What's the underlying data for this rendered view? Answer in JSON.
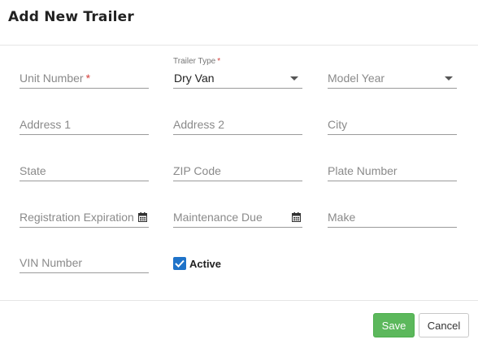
{
  "dialog": {
    "title": "Add New Trailer"
  },
  "form": {
    "unit_number": {
      "placeholder": "Unit Number",
      "required_mark": "*"
    },
    "trailer_type": {
      "label": "Trailer Type",
      "required_mark": "*",
      "value": "Dry Van"
    },
    "model_year": {
      "placeholder": "Model Year"
    },
    "address1": {
      "placeholder": "Address 1"
    },
    "address2": {
      "placeholder": "Address 2"
    },
    "city": {
      "placeholder": "City"
    },
    "state": {
      "placeholder": "State"
    },
    "zip": {
      "placeholder": "ZIP Code"
    },
    "plate_number": {
      "placeholder": "Plate Number"
    },
    "registration_expiration": {
      "placeholder": "Registration Expiration"
    },
    "maintenance_due": {
      "placeholder": "Maintenance Due"
    },
    "make": {
      "placeholder": "Make"
    },
    "vin_number": {
      "placeholder": "VIN Number"
    },
    "active": {
      "label": "Active",
      "checked": true
    }
  },
  "footer": {
    "save_label": "Save",
    "cancel_label": "Cancel"
  },
  "colors": {
    "save_button": "#5cb85c",
    "checkbox": "#1f73c9",
    "required": "#d43f3a"
  }
}
